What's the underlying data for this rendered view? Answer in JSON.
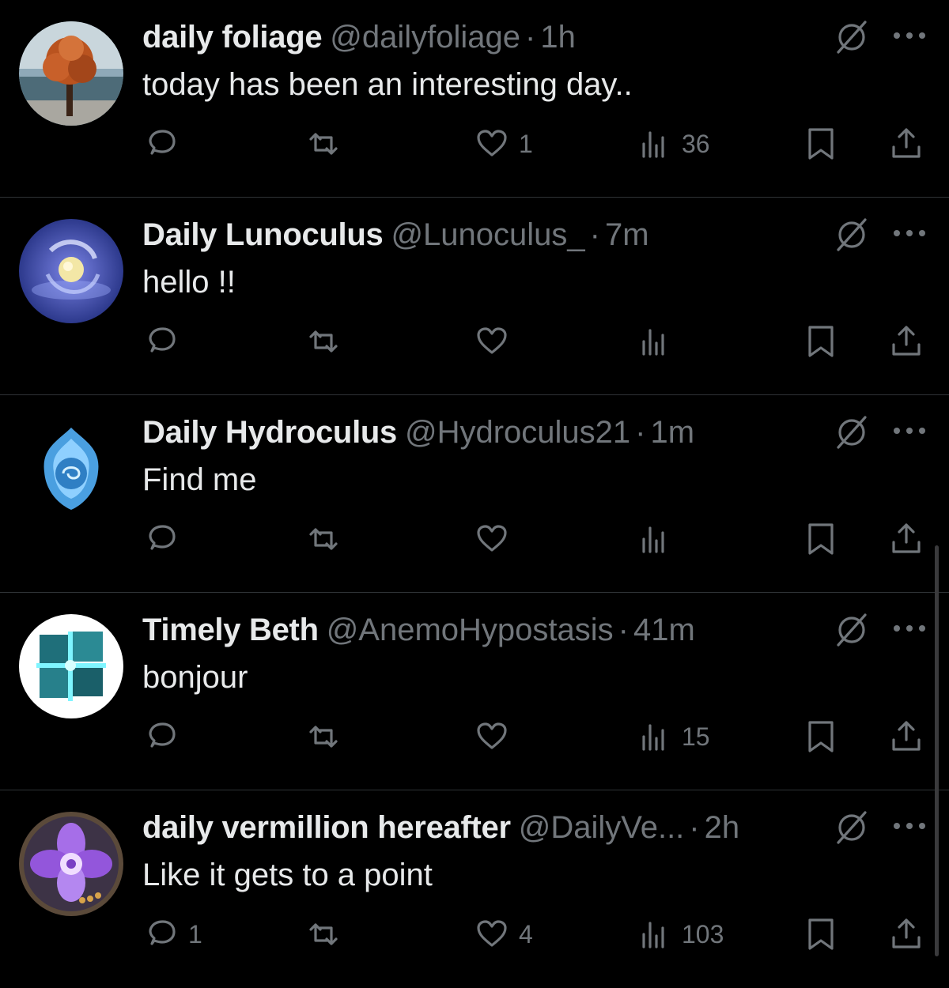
{
  "posts": [
    {
      "name": "daily foliage",
      "handle": "@dailyfoliage",
      "separator": "·",
      "time": "1h",
      "text": "today has been an interesting day..",
      "replies": "",
      "reposts": "",
      "likes": "1",
      "views": "36",
      "avatar": "autumn-tree-avatar"
    },
    {
      "name": "Daily Lunoculus",
      "handle": "@Lunoculus_",
      "separator": "·",
      "time": "7m",
      "text": "hello !!",
      "replies": "",
      "reposts": "",
      "likes": "",
      "views": "",
      "avatar": "lunoculus-avatar"
    },
    {
      "name": "Daily Hydroculus",
      "handle": "@Hydroculus21",
      "separator": "·",
      "time": "1m",
      "text": "Find me",
      "replies": "",
      "reposts": "",
      "likes": "",
      "views": "",
      "avatar": "hydroculus-avatar"
    },
    {
      "name": "Timely Beth",
      "handle": "@AnemoHypostasis",
      "separator": "·",
      "time": "41m",
      "text": "bonjour",
      "replies": "",
      "reposts": "",
      "likes": "",
      "views": "15",
      "avatar": "anemo-cubes-avatar"
    },
    {
      "name": "daily vermillion hereafter",
      "handle": "@DailyVe...",
      "separator": "·",
      "time": "2h",
      "text": "Like it gets to a point",
      "replies": "1",
      "reposts": "",
      "likes": "4",
      "views": "103",
      "avatar": "vermillion-flower-avatar"
    }
  ],
  "icons": {
    "reply": "reply-icon",
    "repost": "repost-icon",
    "like": "heart-icon",
    "views": "views-icon",
    "bookmark": "bookmark-icon",
    "share": "share-icon",
    "grok": "grok-icon",
    "more": "more-icon"
  },
  "colors": {
    "background": "#000000",
    "primary_text": "#e7e9ea",
    "secondary_text": "#71767b",
    "divider": "#2f3336"
  }
}
